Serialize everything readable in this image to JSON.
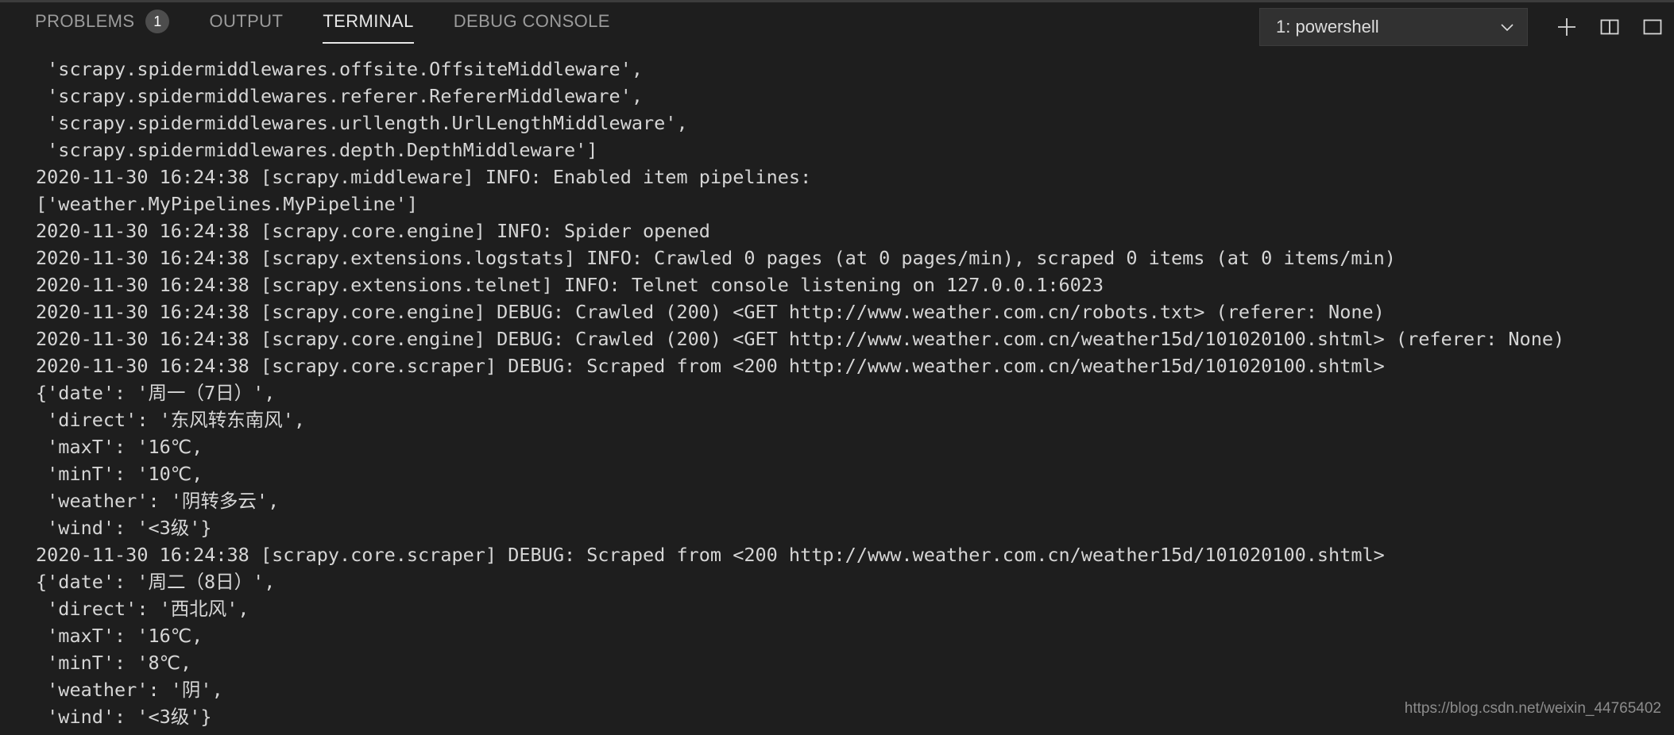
{
  "panel": {
    "tabs": [
      {
        "label": "PROBLEMS",
        "badge": "1",
        "active": false
      },
      {
        "label": "OUTPUT",
        "badge": "",
        "active": false
      },
      {
        "label": "TERMINAL",
        "badge": "",
        "active": true
      },
      {
        "label": "DEBUG CONSOLE",
        "badge": "",
        "active": false
      }
    ]
  },
  "header_actions": {
    "shell_selector": {
      "value": "1: powershell",
      "chevron_icon": "chevron-down-icon"
    },
    "new_terminal_icon": "plus-icon",
    "split_terminal_icon": "split-editor-icon",
    "overflow_icon": "partial-icon"
  },
  "colors": {
    "background": "#1e1e1e",
    "header_background": "#1e1e1e",
    "select_background": "#313131",
    "text": "#d6d6d6",
    "tab_inactive": "#9b9b9b",
    "tab_active": "#e7e7e7",
    "badge_background": "#4d4d4d",
    "topline": "#3c3c3c",
    "watermark": "#8c8c8c"
  },
  "terminal": {
    "lines": [
      " 'scrapy.spidermiddlewares.offsite.OffsiteMiddleware',",
      " 'scrapy.spidermiddlewares.referer.RefererMiddleware',",
      " 'scrapy.spidermiddlewares.urllength.UrlLengthMiddleware',",
      " 'scrapy.spidermiddlewares.depth.DepthMiddleware']",
      "2020-11-30 16:24:38 [scrapy.middleware] INFO: Enabled item pipelines:",
      "['weather.MyPipelines.MyPipeline']",
      "2020-11-30 16:24:38 [scrapy.core.engine] INFO: Spider opened",
      "2020-11-30 16:24:38 [scrapy.extensions.logstats] INFO: Crawled 0 pages (at 0 pages/min), scraped 0 items (at 0 items/min)",
      "2020-11-30 16:24:38 [scrapy.extensions.telnet] INFO: Telnet console listening on 127.0.0.1:6023",
      "2020-11-30 16:24:38 [scrapy.core.engine] DEBUG: Crawled (200) <GET http://www.weather.com.cn/robots.txt> (referer: None)",
      "2020-11-30 16:24:38 [scrapy.core.engine] DEBUG: Crawled (200) <GET http://www.weather.com.cn/weather15d/101020100.shtml> (referer: None)",
      "2020-11-30 16:24:38 [scrapy.core.scraper] DEBUG: Scraped from <200 http://www.weather.com.cn/weather15d/101020100.shtml>",
      "{'date': '周一（7日）',",
      " 'direct': '东风转东南风',",
      " 'maxT': '16℃,",
      " 'minT': '10℃,",
      " 'weather': '阴转多云',",
      " 'wind': '<3级'}",
      "2020-11-30 16:24:38 [scrapy.core.scraper] DEBUG: Scraped from <200 http://www.weather.com.cn/weather15d/101020100.shtml>",
      "{'date': '周二（8日）',",
      " 'direct': '西北风',",
      " 'maxT': '16℃,",
      " 'minT': '8℃,",
      " 'weather': '阴',",
      " 'wind': '<3级'}"
    ]
  },
  "watermark": {
    "text": "https://blog.csdn.net/weixin_44765402"
  }
}
